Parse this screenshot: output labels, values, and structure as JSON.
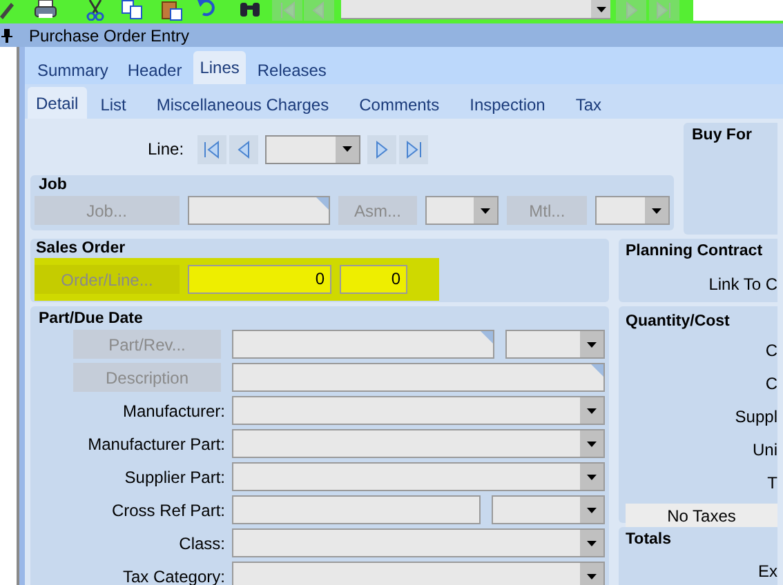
{
  "window": {
    "title": "Purchase Order Entry"
  },
  "tabs": [
    {
      "label": "Summary",
      "selected": false
    },
    {
      "label": "Header",
      "selected": false
    },
    {
      "label": "Lines",
      "selected": true
    },
    {
      "label": "Releases",
      "selected": false
    }
  ],
  "subtabs": [
    {
      "label": "Detail",
      "selected": true
    },
    {
      "label": "List",
      "selected": false
    },
    {
      "label": "Miscellaneous Charges",
      "selected": false
    },
    {
      "label": "Comments",
      "selected": false
    },
    {
      "label": "Inspection",
      "selected": false
    },
    {
      "label": "Tax",
      "selected": false
    }
  ],
  "line_nav": {
    "label": "Line:"
  },
  "job": {
    "title": "Job",
    "job_button": {
      "label": "Job...",
      "disabled": true
    },
    "asm_button": {
      "label": "Asm...",
      "disabled": true
    },
    "mtl_button": {
      "label": "Mtl...",
      "disabled": true
    }
  },
  "buy_for": {
    "title": "Buy For"
  },
  "sales_order": {
    "title": "Sales Order",
    "highlighted": true,
    "button": {
      "label": "Order/Line...",
      "disabled": true
    },
    "order": "0",
    "line": "0"
  },
  "planning_contract": {
    "title": "Planning Contract",
    "label": "Link To C"
  },
  "part": {
    "title": "Part/Due Date",
    "part_button": {
      "label": "Part/Rev...",
      "disabled": true
    },
    "description_button": {
      "label": "Description",
      "disabled": true
    },
    "fields": [
      {
        "label": "Manufacturer:",
        "kind": "combo"
      },
      {
        "label": "Manufacturer Part:",
        "kind": "combo"
      },
      {
        "label": "Supplier Part:",
        "kind": "combo"
      },
      {
        "label": "Cross Ref Part:",
        "kind": "split"
      },
      {
        "label": "Class:",
        "kind": "combo"
      },
      {
        "label": "Tax Category:",
        "kind": "combo"
      }
    ]
  },
  "quantity_cost": {
    "title": "Quantity/Cost",
    "labels": [
      "C",
      "C",
      "Suppl",
      "Uni",
      "T"
    ],
    "button": "No Taxes"
  },
  "totals": {
    "title": "Totals",
    "labels": [
      "Ex"
    ]
  }
}
